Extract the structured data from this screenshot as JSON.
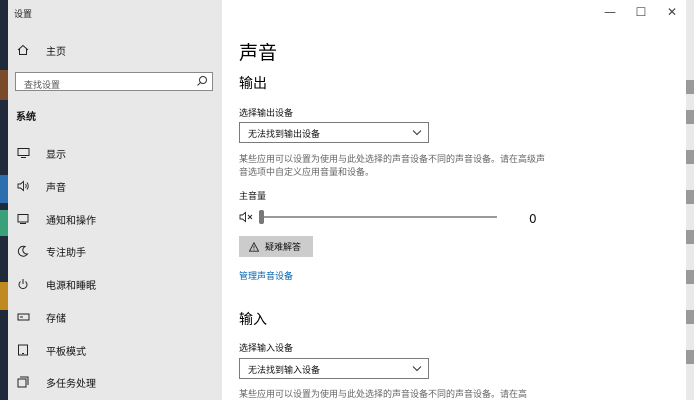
{
  "window": {
    "title": "设置",
    "controls": [
      "—",
      "☐",
      "✕"
    ]
  },
  "sidebar": {
    "home_label": "主页",
    "search_placeholder": "查找设置",
    "section_title": "系统",
    "items": [
      {
        "label": "显示",
        "icon": "monitor-icon"
      },
      {
        "label": "声音",
        "icon": "speaker-icon"
      },
      {
        "label": "通知和操作",
        "icon": "notification-icon"
      },
      {
        "label": "专注助手",
        "icon": "moon-icon"
      },
      {
        "label": "电源和睡眠",
        "icon": "power-icon"
      },
      {
        "label": "存储",
        "icon": "storage-icon"
      },
      {
        "label": "平板模式",
        "icon": "tablet-icon"
      },
      {
        "label": "多任务处理",
        "icon": "multitask-icon"
      }
    ]
  },
  "main": {
    "title": "声音",
    "output": {
      "heading": "输出",
      "device_label": "选择输出设备",
      "device_value": "无法找到输出设备",
      "description": "某些应用可以设置为使用与此处选择的声音设备不同的声音设备。请在高级声音选项中自定义应用音量和设备。",
      "volume_label": "主音量",
      "volume_value": "0",
      "volume_level": 0,
      "troubleshoot_label": "疑难解答",
      "manage_link": "管理声音设备"
    },
    "input": {
      "heading": "输入",
      "device_label": "选择输入设备",
      "device_value": "无法找到输入设备",
      "description": "某些应用可以设置为使用与此处选择的声音设备不同的声音设备。请在高"
    }
  },
  "colors": {
    "sidebar_bg": "#e8e8e8",
    "link": "#0063b1",
    "button_bg": "#cccccc"
  }
}
